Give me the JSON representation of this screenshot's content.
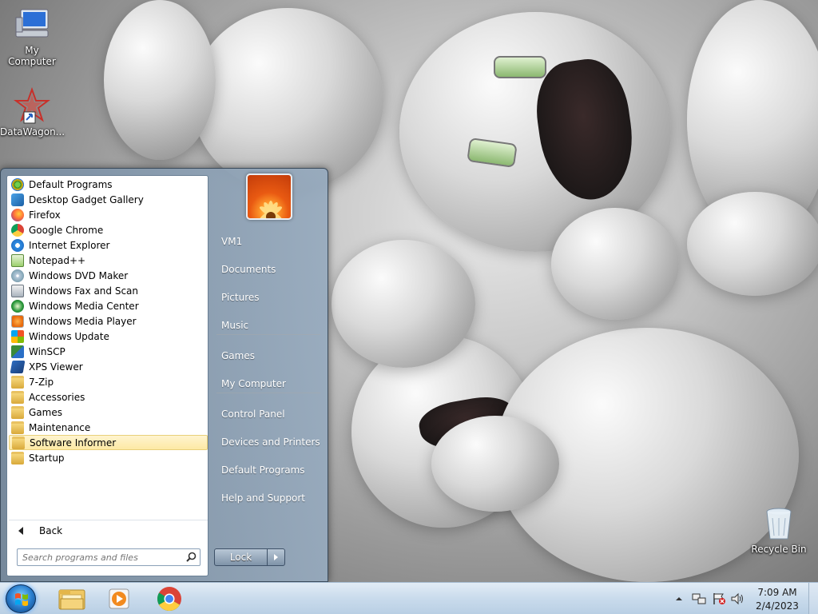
{
  "desktop": {
    "icons": [
      {
        "label": "My Computer"
      },
      {
        "label": "DataWagon..."
      },
      {
        "label": "Recycle Bin"
      }
    ]
  },
  "start_menu": {
    "programs": [
      {
        "label": "Default Programs",
        "icon": "default-programs-icon"
      },
      {
        "label": "Desktop Gadget Gallery",
        "icon": "gadget-icon"
      },
      {
        "label": "Firefox",
        "icon": "firefox-icon"
      },
      {
        "label": "Google Chrome",
        "icon": "chrome-icon"
      },
      {
        "label": "Internet Explorer",
        "icon": "ie-icon"
      },
      {
        "label": "Notepad++",
        "icon": "notepadpp-icon"
      },
      {
        "label": "Windows DVD Maker",
        "icon": "dvd-maker-icon"
      },
      {
        "label": "Windows Fax and Scan",
        "icon": "fax-icon"
      },
      {
        "label": "Windows Media Center",
        "icon": "media-center-icon"
      },
      {
        "label": "Windows Media Player",
        "icon": "media-player-icon"
      },
      {
        "label": "Windows Update",
        "icon": "windows-update-icon"
      },
      {
        "label": "WinSCP",
        "icon": "winscp-icon"
      },
      {
        "label": "XPS Viewer",
        "icon": "xps-viewer-icon"
      },
      {
        "label": "7-Zip",
        "icon": "folder-icon"
      },
      {
        "label": "Accessories",
        "icon": "folder-icon"
      },
      {
        "label": "Games",
        "icon": "folder-icon"
      },
      {
        "label": "Maintenance",
        "icon": "folder-icon"
      },
      {
        "label": "Software Informer",
        "icon": "folder-icon",
        "selected": true
      },
      {
        "label": "Startup",
        "icon": "folder-icon"
      }
    ],
    "back_label": "Back",
    "search_placeholder": "Search programs and files",
    "right_items": [
      {
        "label": "VM1"
      },
      {
        "label": "Documents"
      },
      {
        "label": "Pictures"
      },
      {
        "label": "Music"
      },
      {
        "label": "Games"
      },
      {
        "label": "My Computer"
      },
      {
        "label": "Control Panel"
      },
      {
        "label": "Devices and Printers"
      },
      {
        "label": "Default Programs"
      },
      {
        "label": "Help and Support"
      }
    ],
    "lock_label": "Lock"
  },
  "taskbar": {
    "pinned": [
      "explorer-icon",
      "media-player-icon",
      "chrome-icon"
    ],
    "tray_icons": [
      "show-hidden-icons-chevron",
      "network-icon",
      "action-center-icon",
      "volume-icon"
    ],
    "time": "7:09 AM",
    "date": "2/4/2023"
  }
}
